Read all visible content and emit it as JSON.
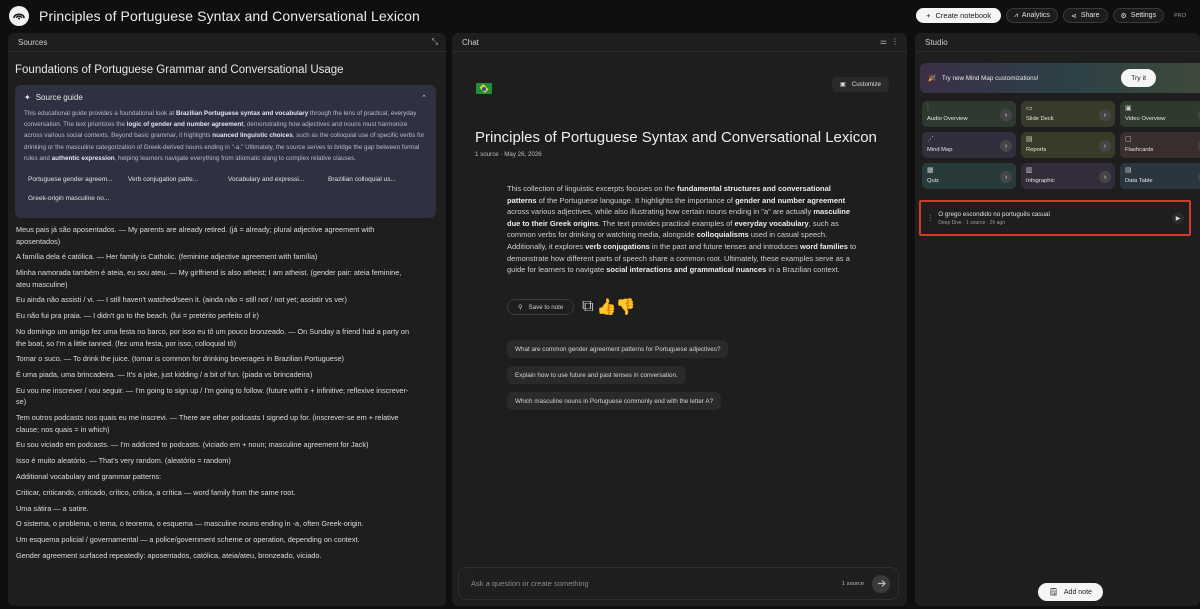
{
  "app": {
    "title": "Principles of Portuguese Syntax and Conversational Lexicon",
    "top_actions": {
      "create": "Create notebook",
      "analytics": "Analytics",
      "share": "Share",
      "settings": "Settings",
      "plan": "PRO"
    }
  },
  "sources": {
    "panel_title": "Sources",
    "doc_title": "Foundations of Portuguese Grammar and Conversational Usage",
    "guide": {
      "label": "Source guide",
      "topics": [
        "Portuguese gender agreem...",
        "Verb conjugation patte...",
        "Vocabulary and expressi...",
        "Brazilian colloquial us...",
        "Greek-origin masculine no..."
      ]
    },
    "lines": [
      "Meus pais já são aposentados. — My parents are already retired. (já = already; plural adjective agreement with aposentados)",
      "A família dela é católica. — Her family is Catholic. (feminine adjective agreement with família)",
      "Minha namorada também é ateia, eu sou ateu. — My girlfriend is also atheist; I am atheist. (gender pair: ateia feminine, ateu masculine)",
      "Eu ainda não assisti / vi. — I still haven't watched/seen it. (ainda não = still not / not yet; assistir vs ver)",
      "Eu não fui pra praia. — I didn't go to the beach. (fui = pretérito perfeito of ir)",
      "No domingo um amigo fez uma festa no barco, por isso eu tô um pouco bronzeado. — On Sunday a friend had a party on the boat, so I'm a little tanned. (fez uma festa, por isso, colloquial tô)",
      "Tomar o suco. — To drink the juice. (tomar is common for drinking beverages in Brazilian Portuguese)",
      "É uma piada, uma brincadeira. — It's a joke, just kidding / a bit of fun. (piada vs brincadeira)",
      "Eu vou me inscrever / vou seguir. — I'm going to sign up / I'm going to follow. (future with ir + infinitive; reflexive inscrever-se)",
      "Tem outros podcasts nos quais eu me inscrevi. — There are other podcasts I signed up for. (inscrever-se em + relative clause; nos quais = in which)",
      "Eu sou viciado em podcasts. — I'm addicted to podcasts. (viciado em + noun; masculine agreement for Jack)",
      "Isso é muito aleatório. — That's very random. (aleatório = random)",
      "Additional vocabulary and grammar patterns:",
      "Criticar, criticando, criticado, crítico, crítica, a crítica — word family from the same root.",
      "Uma sátira — a satire.",
      "O sistema, o problema, o tema, o teorema, o esquema — masculine nouns ending in -a, often Greek-origin.",
      "Um esquema policial / governamental — a police/government scheme or operation, depending on context.",
      "Gender agreement surfaced repeatedly: aposentados, católica, ateia/ateu, bronzeado, viciado."
    ]
  },
  "chat": {
    "panel_title": "Chat",
    "customize": "Customize",
    "notebook_title": "Principles of Portuguese Syntax and Conversational Lexicon",
    "meta": "1 source · May 26, 2026",
    "save_note": "Save to note",
    "suggestions": [
      "What are common gender agreement patterns for Portuguese adjectives?",
      "Explain how to use future and past tenses in conversation.",
      "Which masculine nouns in Portuguese commonly end with the letter A?"
    ],
    "input_placeholder": "Ask a question or create something",
    "source_count": "1 source"
  },
  "studio": {
    "panel_title": "Studio",
    "promo": "Try new Mind Map customizations!",
    "try_it": "Try it",
    "tiles": [
      {
        "label": "Audio Overview",
        "color": "#2e3a2f"
      },
      {
        "label": "Slide Deck",
        "color": "#3a3a2a"
      },
      {
        "label": "Video Overview",
        "color": "#2d3a2d"
      },
      {
        "label": "Mind Map",
        "color": "#2f2f3e"
      },
      {
        "label": "Reports",
        "color": "#3a3a28"
      },
      {
        "label": "Flashcards",
        "color": "#3a2e2e"
      },
      {
        "label": "Quiz",
        "color": "#283a3a"
      },
      {
        "label": "Infographic",
        "color": "#332d3b"
      },
      {
        "label": "Data Table",
        "color": "#2a3540"
      }
    ],
    "audio_item": {
      "title": "O grego escondido no português casual",
      "meta": "Deep Dive · 1 source · 2h ago"
    },
    "add_note": "Add note"
  }
}
